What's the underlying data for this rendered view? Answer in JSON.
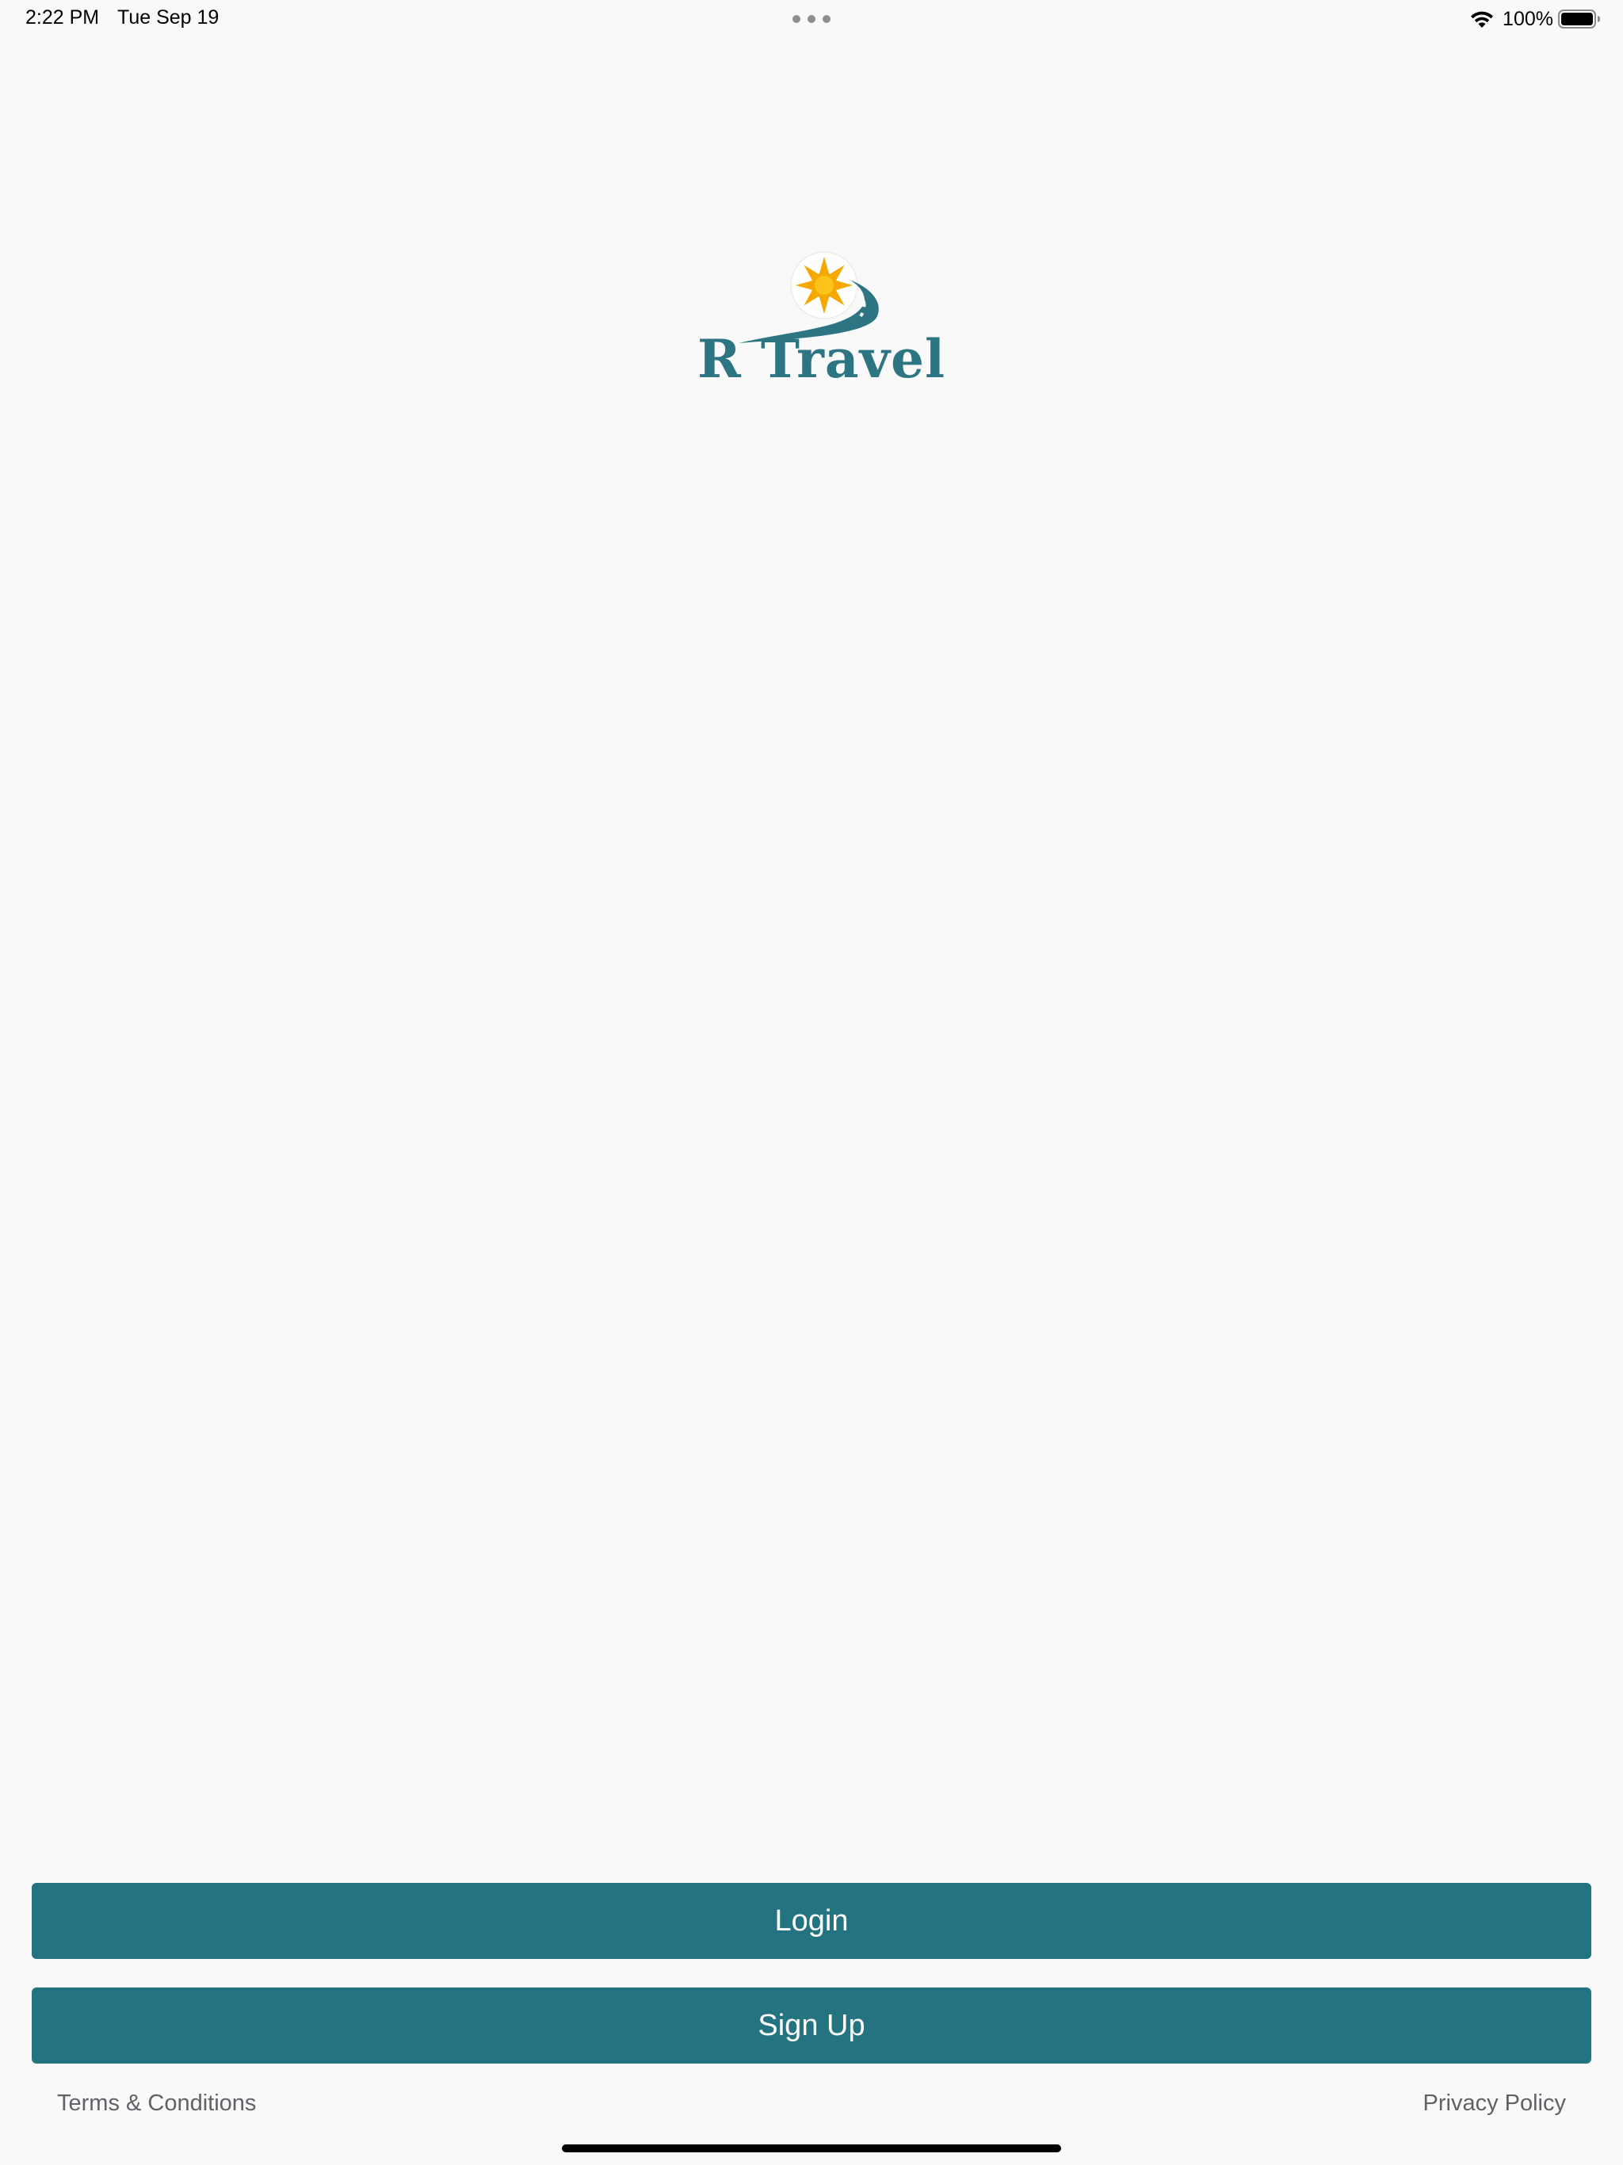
{
  "status_bar": {
    "time": "2:22 PM",
    "date": "Tue Sep 19",
    "battery_percent": "100%",
    "icons": [
      "wifi-icon",
      "battery-icon",
      "multitask-dots-icon"
    ]
  },
  "logo": {
    "wordmark": "R Travel",
    "icon": "sun-road-logo-icon"
  },
  "actions": {
    "login_label": "Login",
    "signup_label": "Sign Up"
  },
  "footer": {
    "terms_label": "Terms & Conditions",
    "privacy_label": "Privacy Policy"
  },
  "colors": {
    "background": "#f9f9f9",
    "primary_button": "#247380",
    "brand_teal": "#2e7584",
    "sun": "#f5a800",
    "footer_text": "#5f6266"
  }
}
